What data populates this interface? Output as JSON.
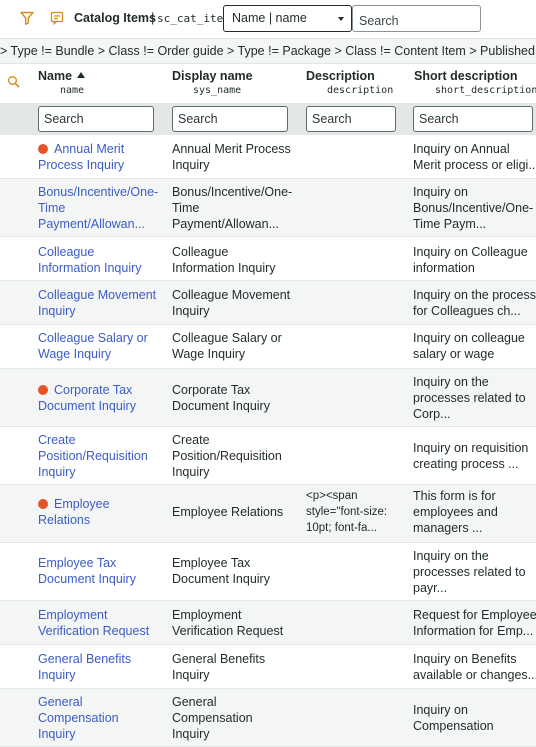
{
  "header": {
    "title": "Catalog Items",
    "separator": "|",
    "table_name": "sc_cat_item",
    "field_select_value": "Name | name",
    "search_placeholder": "Search"
  },
  "breadcrumb": "> Type != Bundle > Class != Order guide > Type != Package > Class != Content Item > Published item is",
  "columns": [
    {
      "title": "Name",
      "field": "name",
      "sorted": "ascending"
    },
    {
      "title": "Display name",
      "field": "sys_name"
    },
    {
      "title": "Description",
      "field": "description"
    },
    {
      "title": "Short description",
      "field": "short_description"
    }
  ],
  "column_search_placeholder": "Search",
  "rows": [
    {
      "name_l1": "Annual Merit",
      "name_l2": "Process Inquiry",
      "name_l3": "",
      "dot": true,
      "display_l1": "Annual Merit Process",
      "display_l2": "Inquiry",
      "display_l3": "",
      "desc_l1": "",
      "desc_l2": "",
      "desc_l3": "",
      "short_l1": "Inquiry on Annual",
      "short_l2": "Merit process or eligi...",
      "short_l3": ""
    },
    {
      "name_l1": "Bonus/Incentive/One-",
      "name_l2": "Time",
      "name_l3": "Payment/Allowan...",
      "dot": false,
      "display_l1": "Bonus/Incentive/One-",
      "display_l2": "Time",
      "display_l3": "Payment/Allowan...",
      "desc_l1": "",
      "desc_l2": "",
      "desc_l3": "",
      "short_l1": "Inquiry on",
      "short_l2": "Bonus/Incentive/One-",
      "short_l3": "Time Paym..."
    },
    {
      "name_l1": "Colleague",
      "name_l2": "Information Inquiry",
      "name_l3": "",
      "dot": false,
      "display_l1": "Colleague",
      "display_l2": "Information Inquiry",
      "display_l3": "",
      "desc_l1": "",
      "desc_l2": "",
      "desc_l3": "",
      "short_l1": "Inquiry on Colleague",
      "short_l2": "information",
      "short_l3": ""
    },
    {
      "name_l1": "Colleague Movement",
      "name_l2": "Inquiry",
      "name_l3": "",
      "dot": false,
      "display_l1": "Colleague Movement",
      "display_l2": "Inquiry",
      "display_l3": "",
      "desc_l1": "",
      "desc_l2": "",
      "desc_l3": "",
      "short_l1": "Inquiry on the process",
      "short_l2": "for Colleagues ch...",
      "short_l3": ""
    },
    {
      "name_l1": "Colleague Salary or",
      "name_l2": "Wage Inquiry",
      "name_l3": "",
      "dot": false,
      "display_l1": "Colleague Salary or",
      "display_l2": "Wage Inquiry",
      "display_l3": "",
      "desc_l1": "",
      "desc_l2": "",
      "desc_l3": "",
      "short_l1": "Inquiry on colleague",
      "short_l2": "salary or wage",
      "short_l3": ""
    },
    {
      "name_l1": "Corporate Tax",
      "name_l2": "Document Inquiry",
      "name_l3": "",
      "dot": true,
      "display_l1": "Corporate Tax",
      "display_l2": "Document Inquiry",
      "display_l3": "",
      "desc_l1": "",
      "desc_l2": "",
      "desc_l3": "",
      "short_l1": "Inquiry on the",
      "short_l2": "processes related to",
      "short_l3": "Corp..."
    },
    {
      "name_l1": "Create",
      "name_l2": "Position/Requisition",
      "name_l3": "Inquiry",
      "dot": false,
      "display_l1": "Create",
      "display_l2": "Position/Requisition",
      "display_l3": "Inquiry",
      "desc_l1": "",
      "desc_l2": "",
      "desc_l3": "",
      "short_l1": "Inquiry on requisition",
      "short_l2": "creating process ...",
      "short_l3": ""
    },
    {
      "name_l1": "Employee",
      "name_l2": "Relations",
      "name_l3": "",
      "dot": true,
      "display_l1": "Employee Relations",
      "display_l2": "",
      "display_l3": "",
      "desc_l1": "<p><span",
      "desc_l2": "style=\"font-size:",
      "desc_l3": "10pt; font-fa...",
      "short_l1": "This form is for",
      "short_l2": "employees and",
      "short_l3": "managers ..."
    },
    {
      "name_l1": "Employee Tax",
      "name_l2": "Document Inquiry",
      "name_l3": "",
      "dot": false,
      "display_l1": "Employee Tax",
      "display_l2": "Document Inquiry",
      "display_l3": "",
      "desc_l1": "",
      "desc_l2": "",
      "desc_l3": "",
      "short_l1": "Inquiry on the",
      "short_l2": "processes related to",
      "short_l3": "payr..."
    },
    {
      "name_l1": "Employment",
      "name_l2": "Verification Request",
      "name_l3": "",
      "dot": false,
      "display_l1": "Employment",
      "display_l2": "Verification Request",
      "display_l3": "",
      "desc_l1": "",
      "desc_l2": "",
      "desc_l3": "",
      "short_l1": "Request for Employee",
      "short_l2": "Information for Emp...",
      "short_l3": ""
    },
    {
      "name_l1": "General Benefits",
      "name_l2": "Inquiry",
      "name_l3": "",
      "dot": false,
      "display_l1": "General Benefits",
      "display_l2": "Inquiry",
      "display_l3": "",
      "desc_l1": "",
      "desc_l2": "",
      "desc_l3": "",
      "short_l1": "Inquiry on Benefits",
      "short_l2": "available or changes...",
      "short_l3": ""
    },
    {
      "name_l1": "General",
      "name_l2": "Compensation",
      "name_l3": "Inquiry",
      "dot": false,
      "display_l1": "General",
      "display_l2": "Compensation",
      "display_l3": "Inquiry",
      "desc_l1": "",
      "desc_l2": "",
      "desc_l3": "",
      "short_l1": "Inquiry on",
      "short_l2": "Compensation",
      "short_l3": ""
    }
  ],
  "colors": {
    "link": "#3b5cc4",
    "attention_dot": "#e4552b",
    "search_row_bg": "#e4e7e7",
    "alt_row_bg": "#f4f5f5",
    "filter_icon": "#d98b1e"
  },
  "icons": {
    "filter": "funnel-icon",
    "context": "context-menu-icon",
    "column_search": "magnifier-icon"
  }
}
